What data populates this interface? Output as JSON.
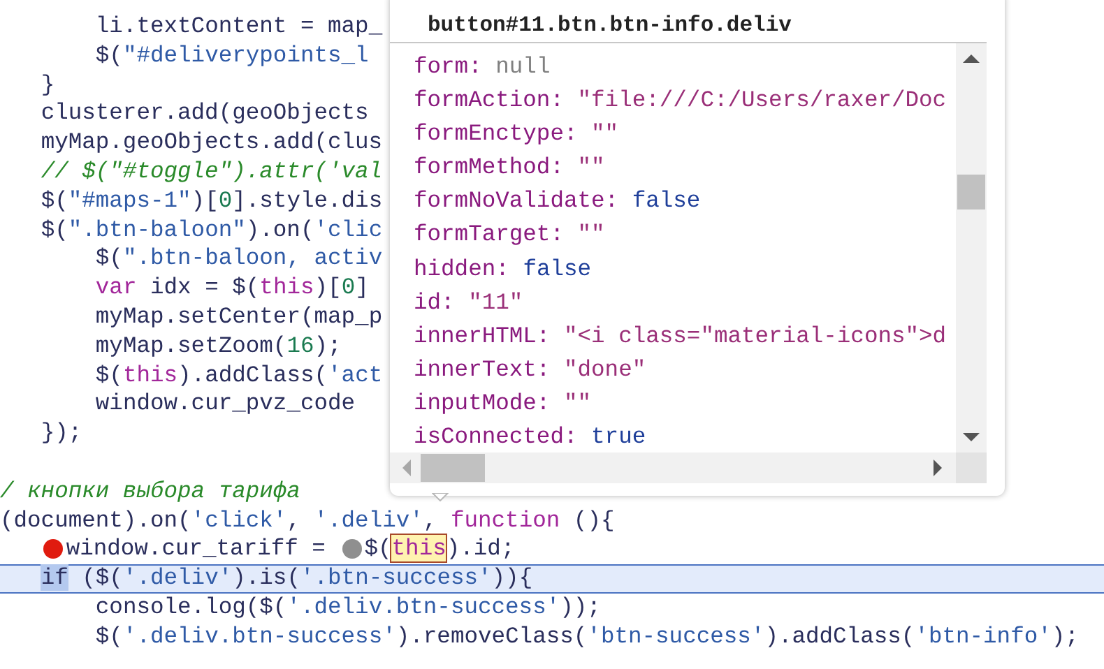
{
  "editor": {
    "lines": [
      {
        "selected": false,
        "tokens": [
          {
            "kind": "plain",
            "text": "       li.textContent = map_"
          }
        ]
      },
      {
        "selected": false,
        "tokens": [
          {
            "kind": "plain",
            "text": "       $("
          },
          {
            "kind": "string",
            "text": "\"#deliverypoints_l"
          }
        ]
      },
      {
        "selected": false,
        "tokens": [
          {
            "kind": "plain",
            "text": "   }"
          }
        ]
      },
      {
        "selected": false,
        "tokens": [
          {
            "kind": "plain",
            "text": "   clusterer.add(geoObjects"
          }
        ]
      },
      {
        "selected": false,
        "tokens": [
          {
            "kind": "plain",
            "text": "   myMap.geoObjects.add(clus"
          }
        ]
      },
      {
        "selected": false,
        "tokens": [
          {
            "kind": "comment",
            "text": "   // $(\"#toggle\").attr('val"
          }
        ]
      },
      {
        "selected": false,
        "tokens": [
          {
            "kind": "plain",
            "text": "   $("
          },
          {
            "kind": "string",
            "text": "\"#maps-1\""
          },
          {
            "kind": "plain",
            "text": ")["
          },
          {
            "kind": "number",
            "text": "0"
          },
          {
            "kind": "plain",
            "text": "].style.dis"
          }
        ]
      },
      {
        "selected": false,
        "tokens": [
          {
            "kind": "plain",
            "text": "   $("
          },
          {
            "kind": "string",
            "text": "\".btn-baloon\""
          },
          {
            "kind": "plain",
            "text": ").on("
          },
          {
            "kind": "string",
            "text": "'clic"
          }
        ]
      },
      {
        "selected": false,
        "tokens": [
          {
            "kind": "plain",
            "text": "       $("
          },
          {
            "kind": "string",
            "text": "\".btn-baloon, activ"
          }
        ]
      },
      {
        "selected": false,
        "tokens": [
          {
            "kind": "keyword",
            "text": "       var"
          },
          {
            "kind": "plain",
            "text": " idx = $("
          },
          {
            "kind": "keyword",
            "text": "this"
          },
          {
            "kind": "plain",
            "text": ")["
          },
          {
            "kind": "number",
            "text": "0"
          },
          {
            "kind": "plain",
            "text": "]"
          }
        ]
      },
      {
        "selected": false,
        "tokens": [
          {
            "kind": "plain",
            "text": "       myMap.setCenter(map_p"
          }
        ]
      },
      {
        "selected": false,
        "tokens": [
          {
            "kind": "plain",
            "text": "       myMap.setZoom("
          },
          {
            "kind": "number",
            "text": "16"
          },
          {
            "kind": "plain",
            "text": ");"
          }
        ]
      },
      {
        "selected": false,
        "tokens": [
          {
            "kind": "plain",
            "text": "       $("
          },
          {
            "kind": "keyword",
            "text": "this"
          },
          {
            "kind": "plain",
            "text": ").addClass("
          },
          {
            "kind": "string",
            "text": "'act"
          }
        ]
      },
      {
        "selected": false,
        "tokens": [
          {
            "kind": "plain",
            "text": "       window.cur_pvz_code"
          }
        ]
      },
      {
        "selected": false,
        "tokens": [
          {
            "kind": "plain",
            "text": "   });"
          }
        ]
      },
      {
        "selected": false
      },
      {
        "selected": false,
        "tokens": [
          {
            "kind": "comment",
            "text": "/ кнопки выбора тарифа"
          }
        ]
      },
      {
        "selected": false,
        "tokens": [
          {
            "kind": "plain",
            "text": "(document).on("
          },
          {
            "kind": "string",
            "text": "'click'"
          },
          {
            "kind": "plain",
            "text": ", "
          },
          {
            "kind": "string",
            "text": "'.deliv'"
          },
          {
            "kind": "plain",
            "text": ", "
          },
          {
            "kind": "keyword",
            "text": "function"
          },
          {
            "kind": "plain",
            "text": " (){"
          }
        ]
      },
      {
        "selected": false,
        "tokens": [
          {
            "kind": "breakpoint"
          },
          {
            "kind": "plain",
            "text": "   window.cur_tariff = "
          },
          {
            "kind": "inline-breakpoint"
          },
          {
            "kind": "plain",
            "text": "$("
          },
          {
            "kind": "hovered",
            "text": "this"
          },
          {
            "kind": "plain",
            "text": ").id;"
          }
        ]
      },
      {
        "selected": true,
        "tokens": [
          {
            "kind": "selection",
            "text": "   if"
          },
          {
            "kind": "plain",
            "text": " ($("
          },
          {
            "kind": "string",
            "text": "'.deliv'"
          },
          {
            "kind": "plain",
            "text": ").is("
          },
          {
            "kind": "string",
            "text": "'.btn-success'"
          },
          {
            "kind": "plain",
            "text": ")){"
          }
        ]
      },
      {
        "selected": false,
        "tokens": [
          {
            "kind": "plain",
            "text": "       console.log($("
          },
          {
            "kind": "string",
            "text": "'.deliv.btn-success'"
          },
          {
            "kind": "plain",
            "text": "));"
          }
        ]
      },
      {
        "selected": false,
        "tokens": [
          {
            "kind": "plain",
            "text": "       $("
          },
          {
            "kind": "string",
            "text": "'.deliv.btn-success'"
          },
          {
            "kind": "plain",
            "text": ").removeClass("
          },
          {
            "kind": "string",
            "text": "'btn-success'"
          },
          {
            "kind": "plain",
            "text": ").addClass("
          },
          {
            "kind": "string",
            "text": "'btn-info'"
          },
          {
            "kind": "plain",
            "text": ");"
          }
        ]
      }
    ]
  },
  "popover": {
    "title": "button#11.btn.btn-info.deliv",
    "properties": [
      {
        "key": "form:",
        "value": "null",
        "kind": "null"
      },
      {
        "key": "formAction:",
        "value": "\"file:///C:/Users/raxer/Doc",
        "kind": "string"
      },
      {
        "key": "formEnctype:",
        "value": "\"\"",
        "kind": "string"
      },
      {
        "key": "formMethod:",
        "value": "\"\"",
        "kind": "string"
      },
      {
        "key": "formNoValidate:",
        "value": "false",
        "kind": "boolean"
      },
      {
        "key": "formTarget:",
        "value": "\"\"",
        "kind": "string"
      },
      {
        "key": "hidden:",
        "value": "false",
        "kind": "boolean"
      },
      {
        "key": "id:",
        "value": "\"11\"",
        "kind": "string"
      },
      {
        "key": "innerHTML:",
        "value": "\"<i class=\"material-icons\">d",
        "kind": "string"
      },
      {
        "key": "innerText:",
        "value": "\"done\"",
        "kind": "string"
      },
      {
        "key": "inputMode:",
        "value": "\"\"",
        "kind": "string"
      },
      {
        "key": "isConnected:",
        "value": "true",
        "kind": "boolean"
      }
    ]
  }
}
